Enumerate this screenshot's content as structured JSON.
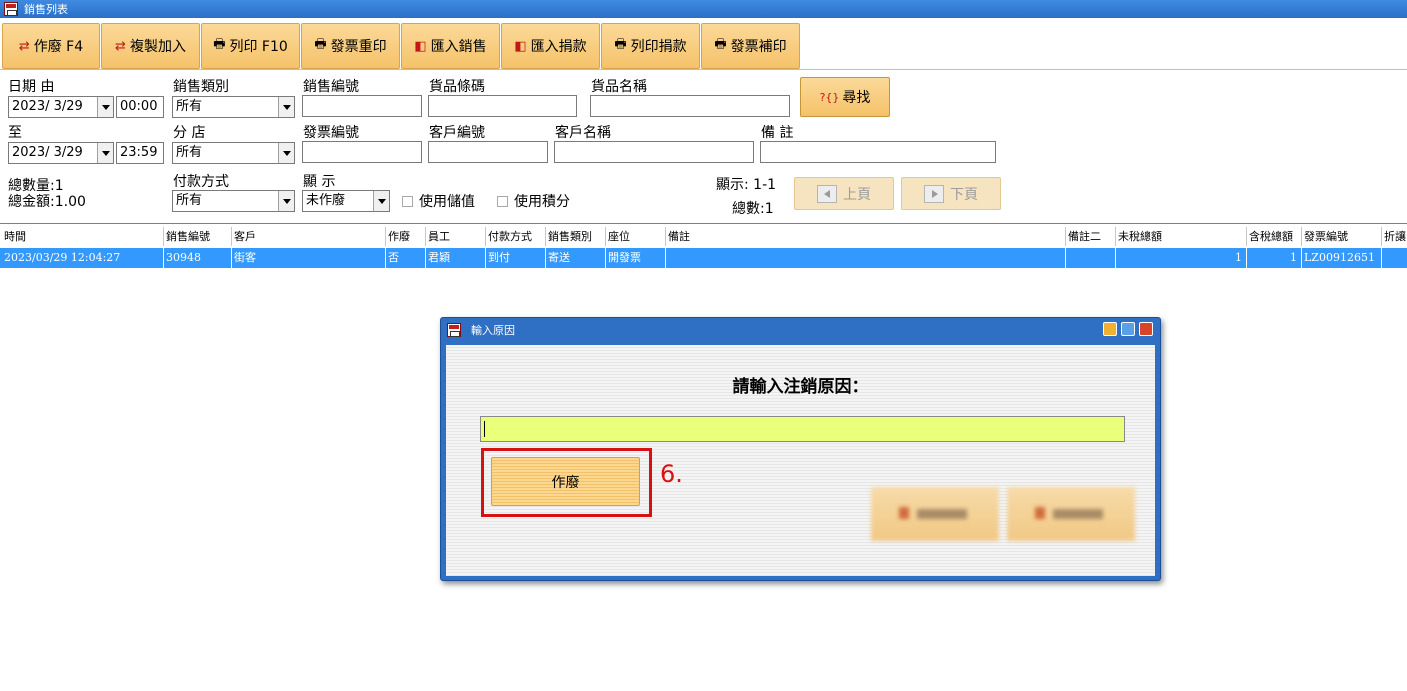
{
  "window": {
    "title": "銷售列表"
  },
  "toolbar": [
    {
      "icon": "swap-arrows-icon",
      "label": "作廢 F4"
    },
    {
      "icon": "swap-arrows-icon",
      "label": "複製加入"
    },
    {
      "icon": "printer-icon",
      "label": "列印 F10"
    },
    {
      "icon": "printer-icon",
      "label": "發票重印"
    },
    {
      "icon": "import-icon",
      "label": "匯入銷售"
    },
    {
      "icon": "import-icon",
      "label": "匯入捐款"
    },
    {
      "icon": "printer-icon",
      "label": "列印捐款"
    },
    {
      "icon": "printer-icon",
      "label": "發票補印"
    }
  ],
  "filters": {
    "date_from_label": "日期 由",
    "date_from": "2023/  3/29",
    "time_from": "00:00",
    "date_to_label": "至",
    "date_to": "2023/  3/29",
    "time_to": "23:59",
    "sale_type_label": "銷售類別",
    "sale_type": "所有",
    "branch_label": "分 店",
    "branch": "所有",
    "payment_label": "付款方式",
    "payment": "所有",
    "sale_no_label": "銷售編號",
    "sale_no": "",
    "invoice_no_label": "發票編號",
    "invoice_no": "",
    "display_label": "顯 示",
    "display": "未作廢",
    "barcode_label": "貨品條碼",
    "barcode": "",
    "customer_no_label": "客戶編號",
    "customer_no": "",
    "use_stored_value_label": "使用儲值",
    "use_points_label": "使用積分",
    "product_name_label": "貨品名稱",
    "product_name": "",
    "customer_name_label": "客戶名稱",
    "customer_name": "",
    "remark_label": "備 註",
    "remark": "",
    "find_label": "尋找",
    "find_icon_text": "?{}"
  },
  "summary": {
    "total_qty": "總數量:1",
    "total_amount": "總金額:1.00",
    "display_range": "顯示: 1-1",
    "total_count": "總數:1"
  },
  "pager": {
    "prev_label": "上頁",
    "next_label": "下頁"
  },
  "table": {
    "columns": [
      "時間",
      "銷售編號",
      "客戶",
      "作廢",
      "員工",
      "付款方式",
      "銷售類別",
      "座位",
      "備註",
      "備註二",
      "未稅總額",
      "含稅總額",
      "發票編號",
      "折讓"
    ],
    "rows": [
      [
        "2023/03/29 12:04:27",
        "30948",
        "街客",
        "否",
        "君穎",
        "到付",
        "寄送",
        "開發票",
        "",
        "",
        "1",
        "1",
        "LZ00912651",
        ""
      ]
    ]
  },
  "dialog": {
    "title": "輸入原因",
    "prompt": "請輸入注銷原因：",
    "reason_value": "",
    "void_label": "作廢",
    "step_label": "6."
  },
  "colors": {
    "accent": "#f5c26a",
    "selection": "#3399ff",
    "highlight": "#d41212",
    "input_bg": "#eaff7a",
    "dialog_frame": "#2f6fc4"
  }
}
